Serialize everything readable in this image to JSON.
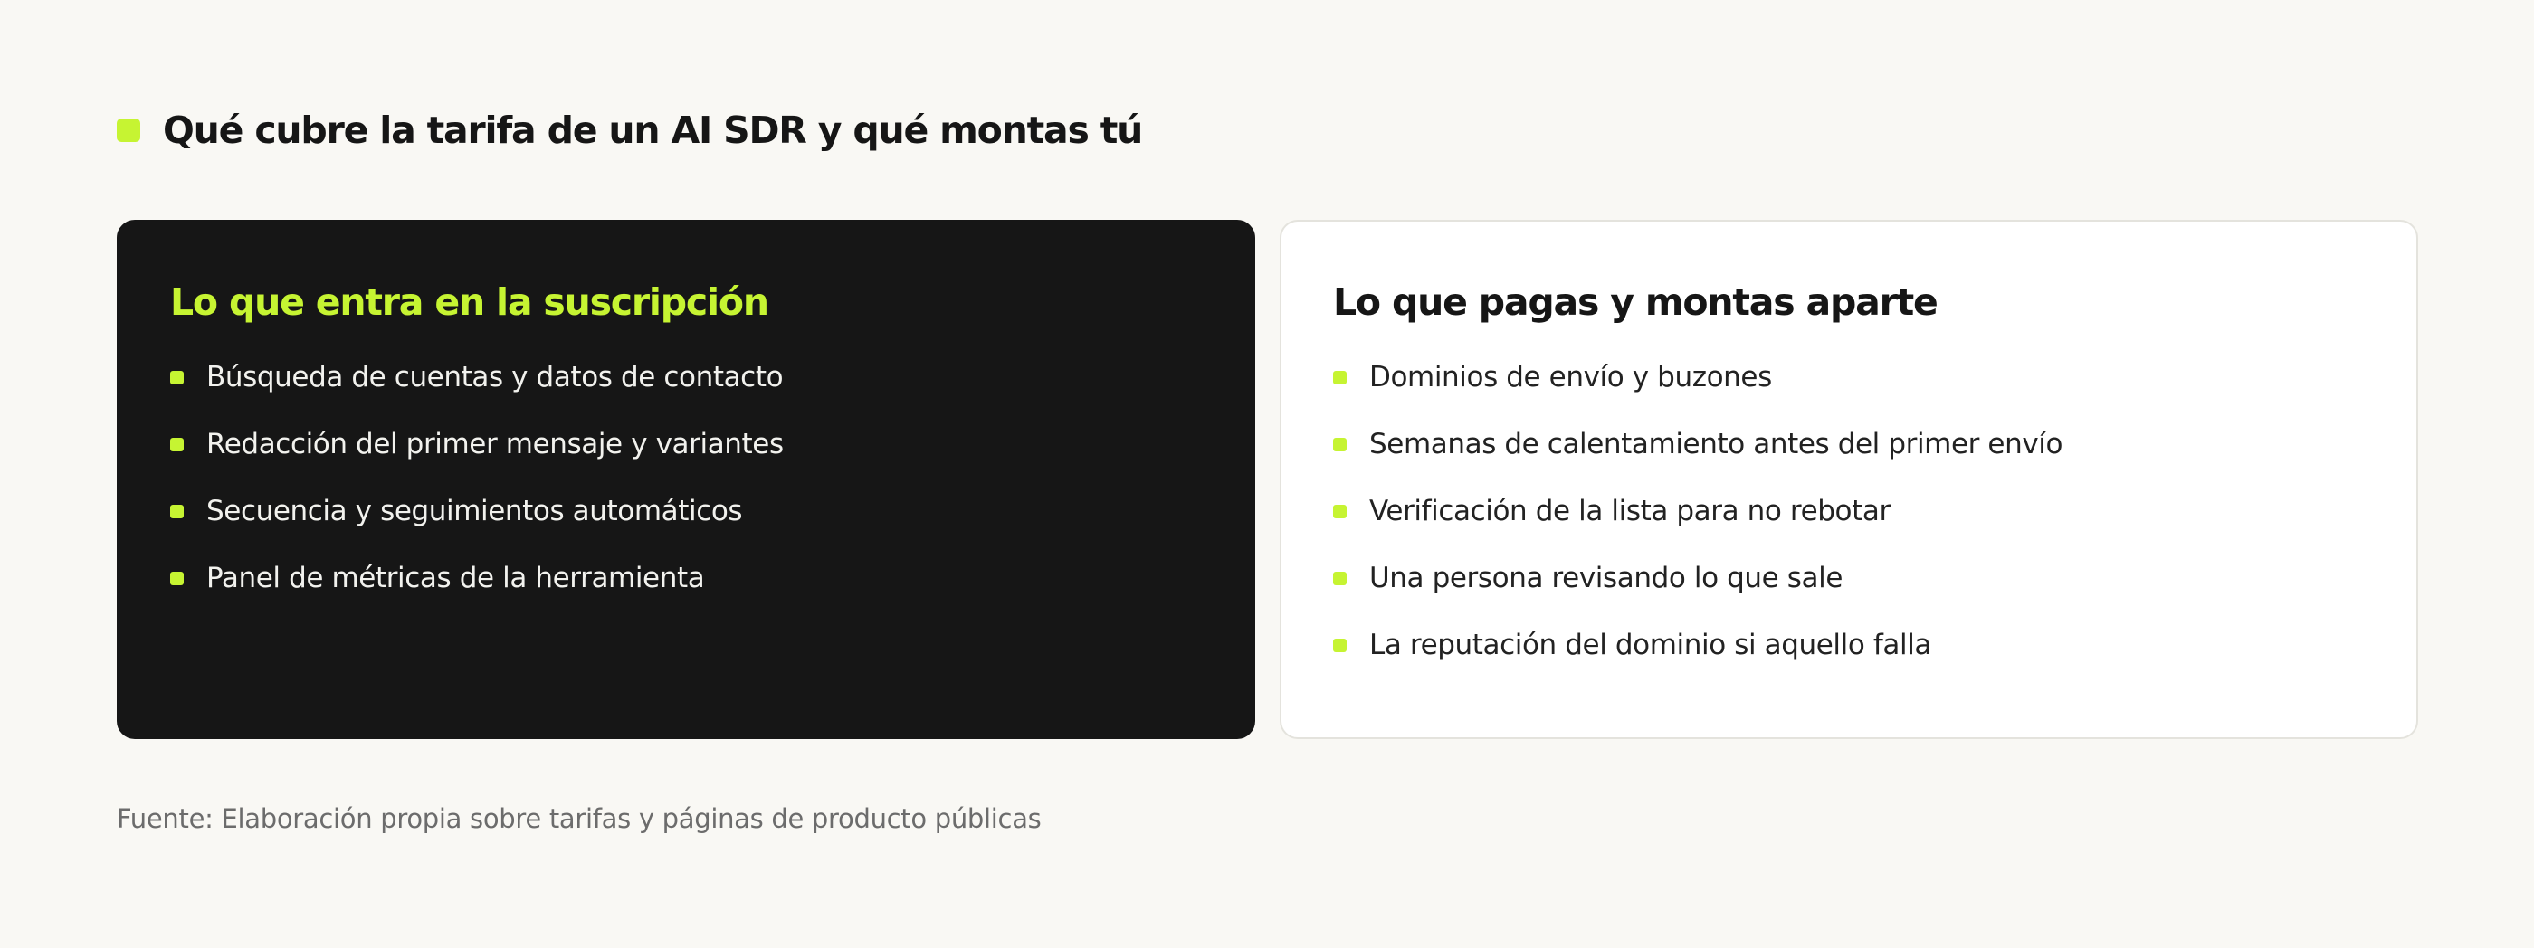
{
  "title": {
    "text": "Qué cubre la tarifa de un AI SDR y qué montas tú",
    "accent_color": "#c6f432"
  },
  "cards": {
    "included": {
      "heading": "Lo que entra en la suscripción",
      "items": [
        "Búsqueda de cuentas y datos de contacto",
        "Redacción del primer mensaje y variantes",
        "Secuencia y seguimientos automáticos",
        "Panel de métricas de la herramienta"
      ],
      "background_color": "#161616",
      "heading_color": "#c6f432"
    },
    "extra": {
      "heading": "Lo que pagas y montas aparte",
      "items": [
        "Dominios de envío y buzones",
        "Semanas de calentamiento antes del primer envío",
        "Verificación de la lista para no rebotar",
        "Una persona revisando lo que sale",
        "La reputación del dominio si aquello falla"
      ],
      "background_color": "#ffffff",
      "heading_color": "#161616"
    }
  },
  "source": "Fuente: Elaboración propia sobre tarifas y páginas de producto públicas",
  "colors": {
    "page_background": "#f9f8f4",
    "bullet": "#c6f432",
    "source_text": "#6c6c6c"
  }
}
